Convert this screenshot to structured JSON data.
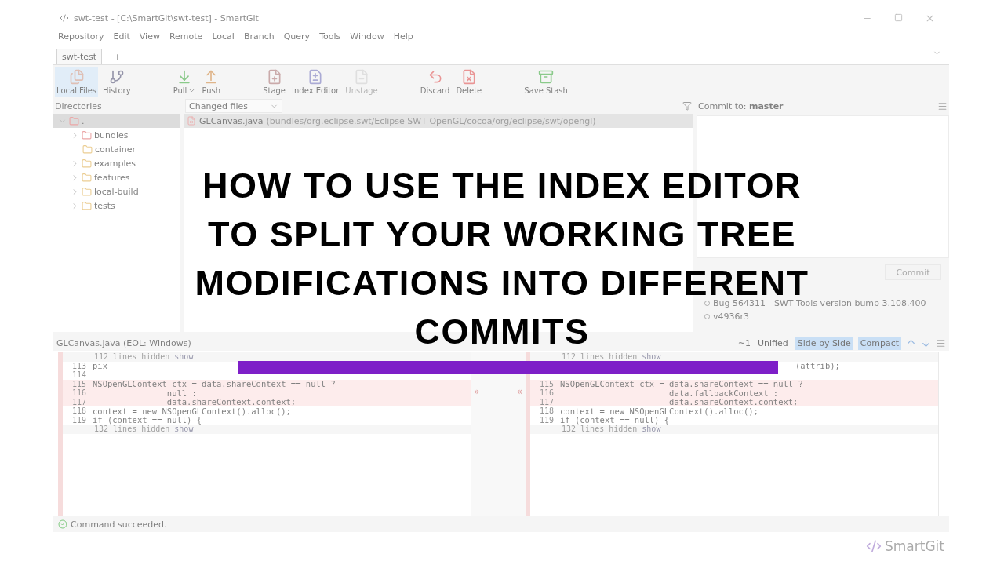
{
  "window": {
    "title": "swt-test - [C:\\SmartGit\\swt-test] - SmartGit"
  },
  "menu": [
    "Repository",
    "Edit",
    "View",
    "Remote",
    "Local",
    "Branch",
    "Query",
    "Tools",
    "Window",
    "Help"
  ],
  "repo_tabs": [
    {
      "label": "swt-test",
      "selected": true
    },
    {
      "label": "+",
      "selected": false
    }
  ],
  "toolbar": [
    [
      {
        "label": "Local Files",
        "selected": true,
        "disabled": false
      },
      {
        "label": "History",
        "selected": false,
        "disabled": false
      }
    ],
    [
      {
        "label": "Pull",
        "dropdown": true,
        "disabled": false
      },
      {
        "label": "Push",
        "disabled": false
      }
    ],
    [
      {
        "label": "Stage",
        "disabled": false
      },
      {
        "label": "Index Editor",
        "disabled": false
      },
      {
        "label": "Unstage",
        "disabled": true
      }
    ],
    [
      {
        "label": "Discard",
        "disabled": false
      },
      {
        "label": "Delete",
        "disabled": false
      }
    ],
    [
      {
        "label": "Save Stash",
        "disabled": false
      }
    ]
  ],
  "directories": {
    "title": "Directories",
    "root": {
      "label": ".",
      "expanded": true,
      "selected": true,
      "children": [
        {
          "label": "bundles",
          "expanded": false,
          "modified": true
        },
        {
          "label": "container",
          "modified": false
        },
        {
          "label": "examples",
          "expanded": false,
          "modified": false
        },
        {
          "label": "features",
          "expanded": false,
          "modified": false
        },
        {
          "label": "local-build",
          "expanded": false,
          "modified": false
        },
        {
          "label": "tests",
          "expanded": false,
          "modified": false
        }
      ]
    }
  },
  "files": {
    "view": "Changed files",
    "rows": [
      {
        "name": "GLCanvas.java",
        "path": "(bundles/org.eclipse.swt/Eclipse SWT OpenGL/cocoa/org/eclipse/swt/opengl)",
        "selected": true
      }
    ]
  },
  "commit": {
    "label": "Commit to:",
    "branch": "master",
    "button": {
      "label": "Commit",
      "disabled": true
    },
    "log": [
      {
        "message": "Bug 564311 - SWT Tools version bump 3.108.400"
      },
      {
        "message": "v4936r3"
      }
    ]
  },
  "diff": {
    "file": "GLCanvas.java (EOL: Windows)",
    "changes": "~1",
    "modes": [
      {
        "label": "Unified",
        "selected": false
      },
      {
        "label": "Side by Side",
        "selected": true
      }
    ],
    "compact": {
      "label": "Compact",
      "on": true
    },
    "left": [
      {
        "kind": "fold",
        "text": "112 lines hidden",
        "link": "show"
      },
      {
        "kind": "line",
        "number": "113",
        "text": "pix",
        "changed": false
      },
      {
        "kind": "line",
        "number": "114",
        "changed": false
      },
      {
        "kind": "line",
        "number": "115",
        "text": "NSOpenGLContext ctx = data.shareContext == null ?",
        "changed": true
      },
      {
        "kind": "line",
        "number": "116",
        "text": "               null :",
        "changed": true
      },
      {
        "kind": "line",
        "number": "117",
        "text": "               data.shareContext.context;",
        "changed": true
      },
      {
        "kind": "line",
        "number": "118",
        "text": "context = new NSOpenGLContext().alloc();",
        "changed": false
      },
      {
        "kind": "line",
        "number": "119",
        "text": "if (context == null) {",
        "changed": false
      },
      {
        "kind": "fold",
        "text": "132 lines hidden",
        "link": "show"
      }
    ],
    "transfer": {
      "right": "»",
      "left": "«"
    },
    "right": [
      {
        "kind": "fold",
        "text": "112 lines hidden",
        "link": "show"
      },
      {
        "kind": "line",
        "text": "(attrib);",
        "changed": false
      },
      {
        "kind": "line"
      },
      {
        "kind": "line",
        "number": "115",
        "text": "NSOpenGLContext ctx = data.shareContext == null ?",
        "changed": true
      },
      {
        "kind": "line",
        "number": "116",
        "text": "                      data.fallbackContext :",
        "changed": true
      },
      {
        "kind": "line",
        "number": "117",
        "text": "                      data.shareContext.context;",
        "changed": true
      },
      {
        "kind": "line",
        "number": "118",
        "text": "context = new NSOpenGLContext().alloc();",
        "changed": false
      },
      {
        "kind": "line",
        "number": "119",
        "text": "if (context == null) {",
        "changed": false
      },
      {
        "kind": "fold",
        "text": "132 lines hidden",
        "link": "show"
      }
    ]
  },
  "status_bar": {
    "text": "Command succeeded."
  },
  "logo": {
    "text": "SmartGit"
  },
  "overlay": {
    "title": [
      "HOW TO USE THE INDEX EDITOR",
      "TO SPLIT YOUR WORKING TREE",
      "MODIFICATIONS INTO DIFFERENT",
      "COMMITS"
    ]
  }
}
